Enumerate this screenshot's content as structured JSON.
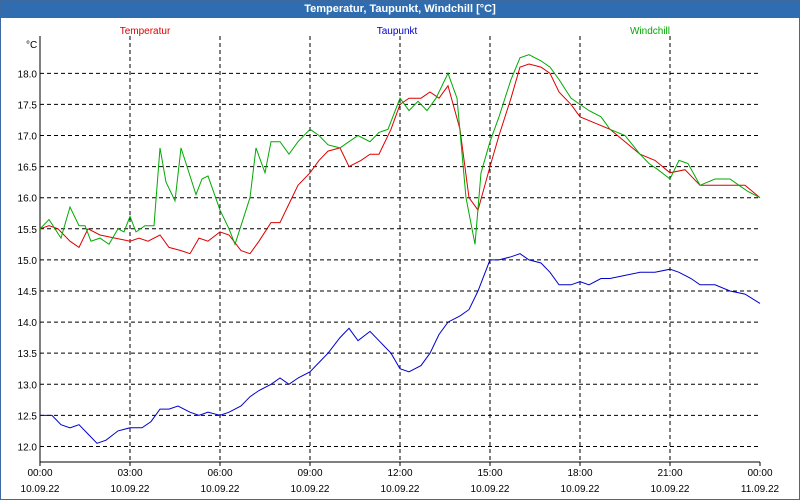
{
  "window": {
    "title": "Temperatur, Taupunkt, Windchill [°C]"
  },
  "chart_data": {
    "type": "line",
    "title": "Temperatur, Taupunkt, Windchill [°C]",
    "ylabel": "°C",
    "ylim": [
      11.75,
      18.6
    ],
    "yticks": [
      "18.0",
      "17.5",
      "17.0",
      "16.5",
      "16.0",
      "15.5",
      "15.0",
      "14.5",
      "14.0",
      "13.5",
      "13.0",
      "12.5",
      "12.0"
    ],
    "ytick_values": [
      18.0,
      17.5,
      17.0,
      16.5,
      16.0,
      15.5,
      15.0,
      14.5,
      14.0,
      13.5,
      13.0,
      12.5,
      12.0
    ],
    "xlim": [
      0,
      24
    ],
    "xticks": [
      {
        "time": "00:00",
        "date": "10.09.22",
        "h": 0
      },
      {
        "time": "03:00",
        "date": "10.09.22",
        "h": 3
      },
      {
        "time": "06:00",
        "date": "10.09.22",
        "h": 6
      },
      {
        "time": "09:00",
        "date": "10.09.22",
        "h": 9
      },
      {
        "time": "12:00",
        "date": "10.09.22",
        "h": 12
      },
      {
        "time": "15:00",
        "date": "10.09.22",
        "h": 15
      },
      {
        "time": "18:00",
        "date": "10.09.22",
        "h": 18
      },
      {
        "time": "21:00",
        "date": "10.09.22",
        "h": 21
      },
      {
        "time": "00:00",
        "date": "11.09.22",
        "h": 24
      }
    ],
    "grid": true,
    "legend_placement": "top",
    "series": [
      {
        "name": "Temperatur",
        "color": "#dd0000",
        "points": [
          [
            0,
            15.5
          ],
          [
            0.3,
            15.55
          ],
          [
            0.6,
            15.5
          ],
          [
            1.0,
            15.3
          ],
          [
            1.3,
            15.2
          ],
          [
            1.6,
            15.5
          ],
          [
            2.0,
            15.4
          ],
          [
            2.5,
            15.35
          ],
          [
            3.0,
            15.3
          ],
          [
            3.3,
            15.35
          ],
          [
            3.6,
            15.3
          ],
          [
            4.0,
            15.4
          ],
          [
            4.3,
            15.2
          ],
          [
            4.7,
            15.15
          ],
          [
            5.0,
            15.1
          ],
          [
            5.3,
            15.35
          ],
          [
            5.6,
            15.3
          ],
          [
            6.0,
            15.45
          ],
          [
            6.3,
            15.4
          ],
          [
            6.7,
            15.15
          ],
          [
            7.0,
            15.1
          ],
          [
            7.3,
            15.3
          ],
          [
            7.7,
            15.6
          ],
          [
            8.0,
            15.6
          ],
          [
            8.3,
            15.9
          ],
          [
            8.6,
            16.2
          ],
          [
            9.0,
            16.4
          ],
          [
            9.3,
            16.6
          ],
          [
            9.6,
            16.75
          ],
          [
            10.0,
            16.8
          ],
          [
            10.3,
            16.5
          ],
          [
            10.7,
            16.6
          ],
          [
            11.0,
            16.7
          ],
          [
            11.3,
            16.7
          ],
          [
            11.7,
            17.1
          ],
          [
            12.0,
            17.5
          ],
          [
            12.3,
            17.6
          ],
          [
            12.7,
            17.6
          ],
          [
            13.0,
            17.7
          ],
          [
            13.3,
            17.6
          ],
          [
            13.6,
            17.8
          ],
          [
            14.0,
            17.1
          ],
          [
            14.3,
            16.0
          ],
          [
            14.6,
            15.8
          ],
          [
            15.0,
            16.5
          ],
          [
            15.3,
            17.0
          ],
          [
            15.7,
            17.6
          ],
          [
            16.0,
            18.1
          ],
          [
            16.3,
            18.15
          ],
          [
            16.7,
            18.1
          ],
          [
            17.0,
            18.0
          ],
          [
            17.3,
            17.7
          ],
          [
            17.7,
            17.5
          ],
          [
            18.0,
            17.3
          ],
          [
            18.5,
            17.2
          ],
          [
            19.0,
            17.1
          ],
          [
            19.5,
            16.9
          ],
          [
            20.0,
            16.7
          ],
          [
            20.5,
            16.6
          ],
          [
            21.0,
            16.4
          ],
          [
            21.5,
            16.45
          ],
          [
            22.0,
            16.2
          ],
          [
            22.5,
            16.2
          ],
          [
            23.0,
            16.2
          ],
          [
            23.5,
            16.2
          ],
          [
            24.0,
            16.0
          ]
        ]
      },
      {
        "name": "Taupunkt",
        "color": "#0000cc",
        "points": [
          [
            0,
            12.5
          ],
          [
            0.4,
            12.5
          ],
          [
            0.7,
            12.35
          ],
          [
            1.0,
            12.3
          ],
          [
            1.3,
            12.35
          ],
          [
            1.6,
            12.2
          ],
          [
            1.9,
            12.05
          ],
          [
            2.2,
            12.1
          ],
          [
            2.6,
            12.25
          ],
          [
            3.0,
            12.3
          ],
          [
            3.4,
            12.3
          ],
          [
            3.7,
            12.4
          ],
          [
            4.0,
            12.6
          ],
          [
            4.3,
            12.6
          ],
          [
            4.6,
            12.65
          ],
          [
            5.0,
            12.55
          ],
          [
            5.3,
            12.5
          ],
          [
            5.6,
            12.55
          ],
          [
            6.0,
            12.5
          ],
          [
            6.3,
            12.55
          ],
          [
            6.7,
            12.65
          ],
          [
            7.0,
            12.8
          ],
          [
            7.3,
            12.9
          ],
          [
            7.7,
            13.0
          ],
          [
            8.0,
            13.1
          ],
          [
            8.3,
            13.0
          ],
          [
            8.6,
            13.1
          ],
          [
            9.0,
            13.2
          ],
          [
            9.3,
            13.35
          ],
          [
            9.6,
            13.5
          ],
          [
            10.0,
            13.75
          ],
          [
            10.3,
            13.9
          ],
          [
            10.6,
            13.7
          ],
          [
            11.0,
            13.85
          ],
          [
            11.3,
            13.7
          ],
          [
            11.7,
            13.5
          ],
          [
            12.0,
            13.25
          ],
          [
            12.3,
            13.2
          ],
          [
            12.7,
            13.3
          ],
          [
            13.0,
            13.5
          ],
          [
            13.3,
            13.8
          ],
          [
            13.6,
            14.0
          ],
          [
            14.0,
            14.1
          ],
          [
            14.3,
            14.2
          ],
          [
            14.6,
            14.5
          ],
          [
            15.0,
            15.0
          ],
          [
            15.3,
            15.0
          ],
          [
            15.7,
            15.05
          ],
          [
            16.0,
            15.1
          ],
          [
            16.3,
            15.0
          ],
          [
            16.7,
            14.95
          ],
          [
            17.0,
            14.8
          ],
          [
            17.3,
            14.6
          ],
          [
            17.7,
            14.6
          ],
          [
            18.0,
            14.65
          ],
          [
            18.3,
            14.6
          ],
          [
            18.7,
            14.7
          ],
          [
            19.0,
            14.7
          ],
          [
            19.5,
            14.75
          ],
          [
            20.0,
            14.8
          ],
          [
            20.5,
            14.8
          ],
          [
            21.0,
            14.85
          ],
          [
            21.3,
            14.8
          ],
          [
            21.7,
            14.7
          ],
          [
            22.0,
            14.6
          ],
          [
            22.5,
            14.6
          ],
          [
            23.0,
            14.5
          ],
          [
            23.5,
            14.45
          ],
          [
            24.0,
            14.3
          ]
        ]
      },
      {
        "name": "Windchill",
        "color": "#00aa00",
        "points": [
          [
            0,
            15.5
          ],
          [
            0.3,
            15.65
          ],
          [
            0.5,
            15.5
          ],
          [
            0.7,
            15.35
          ],
          [
            1.0,
            15.85
          ],
          [
            1.3,
            15.55
          ],
          [
            1.5,
            15.55
          ],
          [
            1.7,
            15.3
          ],
          [
            2.0,
            15.35
          ],
          [
            2.3,
            15.25
          ],
          [
            2.6,
            15.5
          ],
          [
            2.8,
            15.45
          ],
          [
            3.0,
            15.7
          ],
          [
            3.2,
            15.45
          ],
          [
            3.5,
            15.55
          ],
          [
            3.8,
            15.55
          ],
          [
            4.0,
            16.8
          ],
          [
            4.2,
            16.25
          ],
          [
            4.5,
            15.95
          ],
          [
            4.7,
            16.8
          ],
          [
            5.0,
            16.35
          ],
          [
            5.2,
            16.05
          ],
          [
            5.4,
            16.3
          ],
          [
            5.6,
            16.35
          ],
          [
            6.0,
            15.8
          ],
          [
            6.3,
            15.5
          ],
          [
            6.5,
            15.25
          ],
          [
            6.7,
            15.55
          ],
          [
            7.0,
            16.0
          ],
          [
            7.2,
            16.8
          ],
          [
            7.5,
            16.4
          ],
          [
            7.7,
            16.9
          ],
          [
            8.0,
            16.9
          ],
          [
            8.3,
            16.7
          ],
          [
            8.6,
            16.9
          ],
          [
            9.0,
            17.1
          ],
          [
            9.3,
            17.0
          ],
          [
            9.6,
            16.85
          ],
          [
            10.0,
            16.8
          ],
          [
            10.3,
            16.9
          ],
          [
            10.6,
            17.0
          ],
          [
            11.0,
            16.9
          ],
          [
            11.3,
            17.05
          ],
          [
            11.6,
            17.1
          ],
          [
            12.0,
            17.6
          ],
          [
            12.3,
            17.4
          ],
          [
            12.6,
            17.55
          ],
          [
            12.9,
            17.4
          ],
          [
            13.2,
            17.6
          ],
          [
            13.6,
            18.0
          ],
          [
            13.9,
            17.6
          ],
          [
            14.2,
            16.0
          ],
          [
            14.5,
            15.25
          ],
          [
            14.7,
            16.4
          ],
          [
            15.0,
            16.9
          ],
          [
            15.3,
            17.3
          ],
          [
            15.7,
            17.9
          ],
          [
            16.0,
            18.25
          ],
          [
            16.3,
            18.3
          ],
          [
            16.7,
            18.2
          ],
          [
            17.0,
            18.1
          ],
          [
            17.3,
            17.9
          ],
          [
            17.7,
            17.6
          ],
          [
            18.0,
            17.5
          ],
          [
            18.3,
            17.4
          ],
          [
            18.7,
            17.3
          ],
          [
            19.0,
            17.1
          ],
          [
            19.5,
            17.0
          ],
          [
            20.0,
            16.7
          ],
          [
            20.3,
            16.55
          ],
          [
            20.6,
            16.45
          ],
          [
            21.0,
            16.3
          ],
          [
            21.3,
            16.6
          ],
          [
            21.6,
            16.55
          ],
          [
            22.0,
            16.2
          ],
          [
            22.5,
            16.3
          ],
          [
            23.0,
            16.3
          ],
          [
            23.3,
            16.2
          ],
          [
            23.6,
            16.1
          ],
          [
            24.0,
            16.0
          ]
        ]
      }
    ]
  }
}
